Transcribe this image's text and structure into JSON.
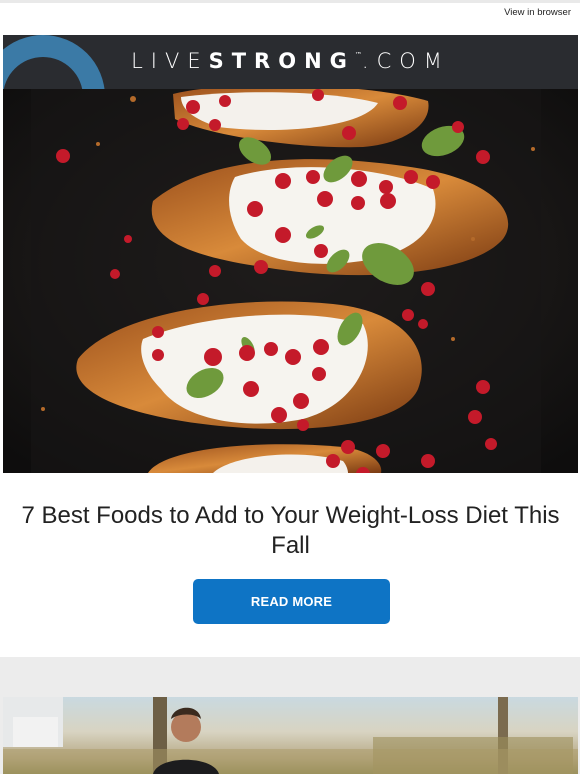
{
  "header": {
    "view_in_browser": "View in browser"
  },
  "brand": {
    "logo_light": "LIVE",
    "logo_bold": "STRONG",
    "logo_tm": "™",
    "logo_suffix": ".COM"
  },
  "article": {
    "hero_alt": "Baked sweet potatoes with yogurt, pomegranate seeds and mint",
    "headline": "7 Best Foods to Add to Your Weight-Loss Diet This Fall",
    "cta_label": "READ MORE"
  },
  "colors": {
    "brand_bar": "#2a2c30",
    "cta": "#0e74c5",
    "band": "#ececec"
  },
  "icons": {
    "brand_arc": "brand-arc-shape"
  }
}
